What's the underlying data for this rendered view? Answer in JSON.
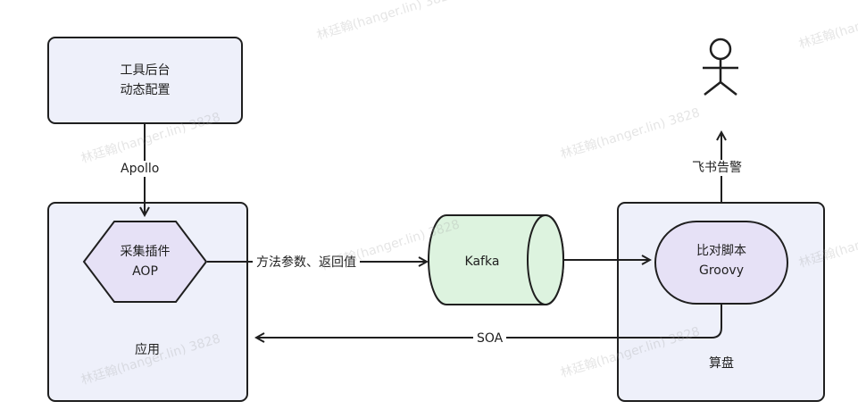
{
  "nodes": {
    "tool_backend": {
      "line1": "工具后台",
      "line2": "动态配置"
    },
    "app": {
      "label": "应用"
    },
    "collector": {
      "line1": "采集插件",
      "line2": "AOP"
    },
    "kafka": {
      "label": "Kafka"
    },
    "suanpan": {
      "label": "算盘"
    },
    "compare": {
      "line1": "比对脚本",
      "line2": "Groovy"
    },
    "user": {
      "icon": "stick-figure-user-icon"
    }
  },
  "edges": {
    "apollo": "Apollo",
    "params": "方法参数、返回值",
    "soa": "SOA",
    "feishu": "飞书告警"
  },
  "watermark": {
    "text": "林廷翰(hanger.lin) 3828"
  },
  "colors": {
    "box_fill": "#eef0fa",
    "hex_fill": "#e6e1f6",
    "kafka_fill": "#ddf3df",
    "stroke": "#1f1f1f"
  }
}
